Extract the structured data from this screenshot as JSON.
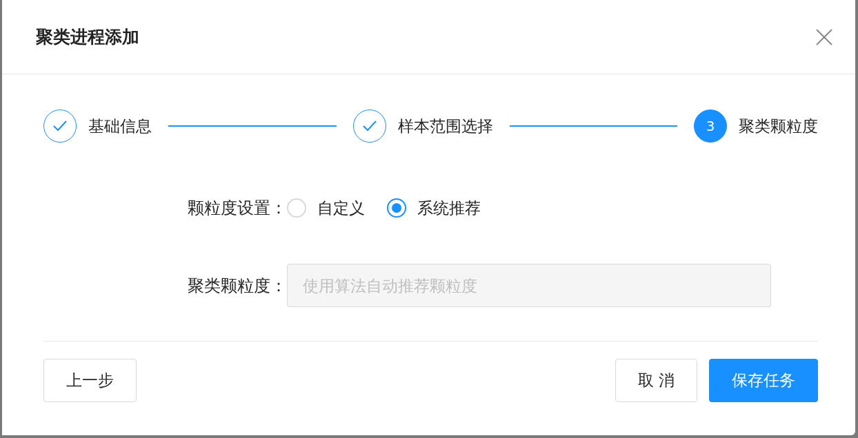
{
  "dialog": {
    "title": "聚类进程添加"
  },
  "steps": [
    {
      "label": "基础信息",
      "completed": true
    },
    {
      "label": "样本范围选择",
      "completed": true
    },
    {
      "label": "聚类颗粒度",
      "completed": false,
      "number": "3"
    }
  ],
  "form": {
    "granularity_setting": {
      "label": "颗粒度设置：",
      "options": [
        {
          "label": "自定义",
          "selected": false
        },
        {
          "label": "系统推荐",
          "selected": true
        }
      ]
    },
    "granularity": {
      "label": "聚类颗粒度：",
      "placeholder": "使用算法自动推荐颗粒度",
      "disabled": true
    }
  },
  "footer": {
    "left_buttons": [
      {
        "label": "上一步",
        "kind": "default"
      }
    ],
    "right_buttons": [
      {
        "label": "取 消",
        "kind": "default"
      },
      {
        "label": "保存任务",
        "kind": "primary"
      }
    ]
  }
}
